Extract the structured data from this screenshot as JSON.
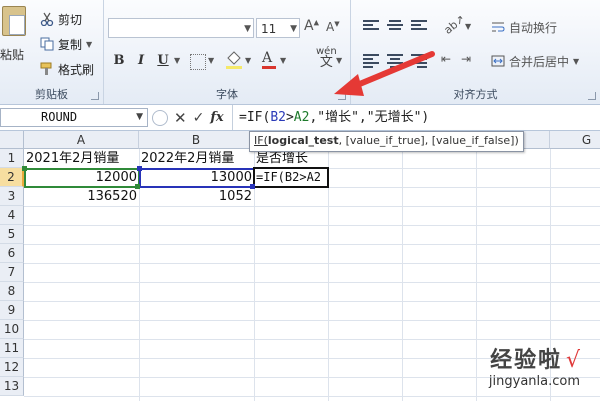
{
  "ribbon": {
    "clipboard": {
      "paste_label": "粘贴",
      "cut_label": "剪切",
      "copy_label": "复制",
      "format_painter_label": "格式刷",
      "group_label": "剪贴板"
    },
    "font": {
      "font_name": "",
      "font_size": "11",
      "bold": "B",
      "italic": "I",
      "underline": "U",
      "group_label": "字体"
    },
    "alignment": {
      "wrap_text_label": "自动换行",
      "merge_center_label": "合并后居中",
      "group_label": "对齐方式"
    }
  },
  "formula_bar": {
    "name_box": "ROUND",
    "formula_prefix": "=IF(",
    "formula_b2": "B2",
    "formula_gt": ">",
    "formula_a2": "A2",
    "formula_rest": ",\"增长\",\"无增长\")",
    "tooltip": {
      "fn": "IF(",
      "arg1": "logical_test",
      "arg_rest": ", [value_if_true], [value_if_false])"
    }
  },
  "sheet": {
    "columns": [
      "A",
      "B",
      "C",
      "D",
      "E",
      "F",
      "G"
    ],
    "rows": [
      "1",
      "2",
      "3",
      "4",
      "5",
      "6",
      "7",
      "8",
      "9",
      "10",
      "11",
      "12",
      "13"
    ],
    "cells": {
      "A1": "2021年2月销量",
      "B1": "2022年2月销量",
      "C1": "是否增长",
      "A2": "12000",
      "B2": "13000",
      "C2": "=IF(B2>A2",
      "A3": "136520",
      "B3": "1052"
    },
    "active_cell": "C2"
  },
  "watermark": {
    "title": "经验啦",
    "check": "√",
    "url": "jingyanla.com"
  },
  "colors": {
    "ref_b": "#2a3ab8",
    "ref_a": "#1d7a2b",
    "arrow": "#e53935"
  }
}
